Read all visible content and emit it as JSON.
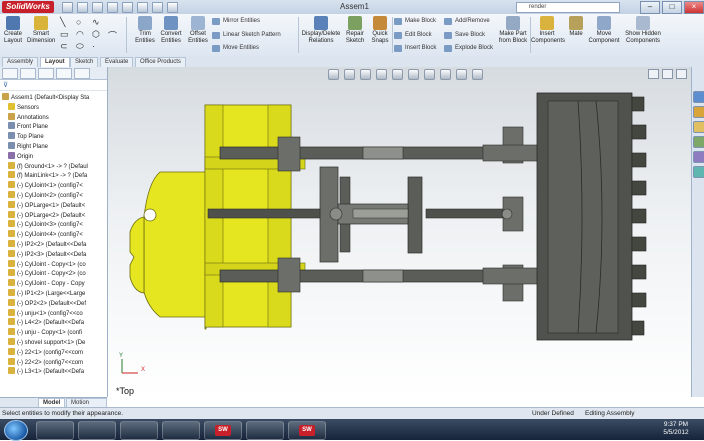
{
  "app": {
    "brand": "SolidWorks",
    "document_title": "Assem1",
    "search_placeholder": "render"
  },
  "ribbon": {
    "create_layout": "Create Layout",
    "smart_dimension": "Smart Dimension",
    "trim_entities": "Trim Entities",
    "convert_entities": "Convert Entities",
    "offset_entities": "Offset Entities",
    "mirror_entities": "Mirror Entities",
    "linear_sketch_pattern": "Linear Sketch Pattern",
    "move_entities": "Move Entities",
    "display_delete_relations": "Display/Delete Relations",
    "repair_sketch": "Repair Sketch",
    "quick_snaps": "Quick Snaps",
    "make_block": "Make Block",
    "edit_block": "Edit Block",
    "insert_block": "Insert Block",
    "add_remove": "Add/Remove",
    "save_block": "Save Block",
    "explode_block": "Explode Block",
    "make_part_from_block": "Make Part from Block",
    "insert_components": "Insert Components",
    "mate": "Mate",
    "move_component": "Move Component",
    "show_hidden_components": "Show Hidden Components"
  },
  "command_tabs": [
    "Assembly",
    "Layout",
    "Sketch",
    "Evaluate",
    "Office Products"
  ],
  "tree": {
    "root": "Assem1  (Default<Display Sta",
    "items": [
      "Sensors",
      "Annotations",
      "Front Plane",
      "Top Plane",
      "Right Plane",
      "Origin",
      "(f) Ground<1> -> ? (Defaul",
      "(f) MainLink<1> -> ? (Defa",
      "(-) CylJoint<1> (config7<",
      "(-) CylJoint<2> (config7<",
      "(-) OPLarge<1> (Default<",
      "(-) OPLarge<2> (Default<",
      "(-) CylJoint<3> (config7<",
      "(-) CylJoint<4> (config7<",
      "(-) IP2<2> (Default<<Defa",
      "(-) IP2<3> (Default<<Defa",
      "(-) CylJoint - Copy<1> (co",
      "(-) CylJoint - Copy<2> (co",
      "(-) CylJoint - Copy - Copy",
      "(-) IP1<2> (Large<<Large",
      "(-) OP2<2> (Default<<Def",
      "(-) unju<1> (config7<<co",
      "(-) L4<2> (Default<<Defa",
      "(-) unju - Copy<1> (confi",
      "(-) shovel support<1> (De",
      "(-) 22<1> (config7<<com",
      "(-) 22<2> (config7<<com",
      "(-) L3<1> (Default<<Defa"
    ]
  },
  "viewport": {
    "view_label": "*Top",
    "axis_x": "X",
    "axis_y": "Y"
  },
  "bottom_tabs": [
    "Model",
    "Motion Study 1"
  ],
  "status": {
    "hint": "Select entities to modify their appearance.",
    "definition": "Under Defined",
    "mode": "Editing Assembly"
  },
  "clock": {
    "time": "9:37 PM",
    "date": "5/5/2012"
  },
  "colors": {
    "accent_red": "#c8202a",
    "ground_yellow": "#e6e620",
    "part_gray": "#5a5d58",
    "part_dark": "#3d3f3b",
    "taskbar": "#1d2c42"
  }
}
